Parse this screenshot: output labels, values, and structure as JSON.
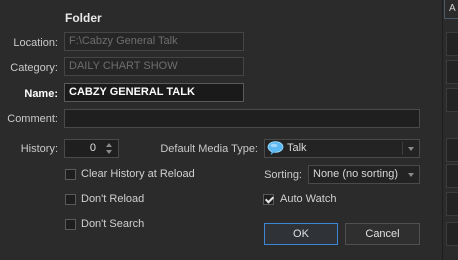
{
  "section": {
    "title": "Folder"
  },
  "fields": {
    "location": {
      "label": "Location:",
      "value": "F:\\Cabzy General Talk"
    },
    "category": {
      "label": "Category:",
      "value": "DAILY CHART SHOW"
    },
    "name": {
      "label": "Name:",
      "value": "CABZY GENERAL TALK"
    },
    "comment": {
      "label": "Comment:",
      "value": ""
    }
  },
  "history": {
    "label": "History:",
    "value": "0"
  },
  "media_type": {
    "label": "Default Media Type:",
    "value": "Talk",
    "icon": "speech-bubble-icon"
  },
  "sorting": {
    "label": "Sorting:",
    "value": "None (no sorting)"
  },
  "options": {
    "clear_history": {
      "label": "Clear History at Reload",
      "checked": false
    },
    "dont_reload": {
      "label": "Don't Reload",
      "checked": false
    },
    "dont_search": {
      "label": "Don't Search",
      "checked": false
    },
    "auto_watch": {
      "label": "Auto Watch",
      "checked": true
    }
  },
  "buttons": {
    "ok": "OK",
    "cancel": "Cancel"
  },
  "side": {
    "tab_letter": "A"
  },
  "colors": {
    "background": "#2b2b2b",
    "accent": "#3d86d4",
    "field": "#1f1f1f"
  }
}
